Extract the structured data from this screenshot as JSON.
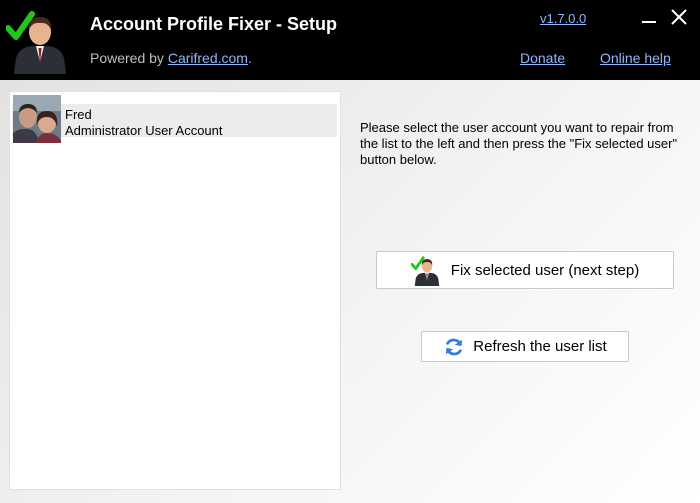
{
  "header": {
    "title": "Account Profile Fixer - Setup",
    "powered_prefix": "Powered by ",
    "powered_link": "Carifred.com",
    "powered_suffix": ".",
    "version": "v1.7.0.0",
    "donate": "Donate",
    "help": "Online help",
    "minimize_glyph": "—",
    "close_glyph": "✕"
  },
  "users": [
    {
      "name": "Fred",
      "type": "Administrator User Account"
    }
  ],
  "instructions": "Please select the user account you want to repair from the list to the left and then press the \"Fix selected user\" button below.",
  "buttons": {
    "fix": "Fix selected user (next step)",
    "refresh": "Refresh the user list"
  },
  "colors": {
    "header_bg": "#000000",
    "link": "#8fb6ff",
    "check_green": "#22c41e",
    "refresh_blue": "#2f7fe0"
  },
  "icons": {
    "logo": "user-check-icon",
    "fix": "user-check-icon",
    "refresh": "refresh-icon"
  }
}
